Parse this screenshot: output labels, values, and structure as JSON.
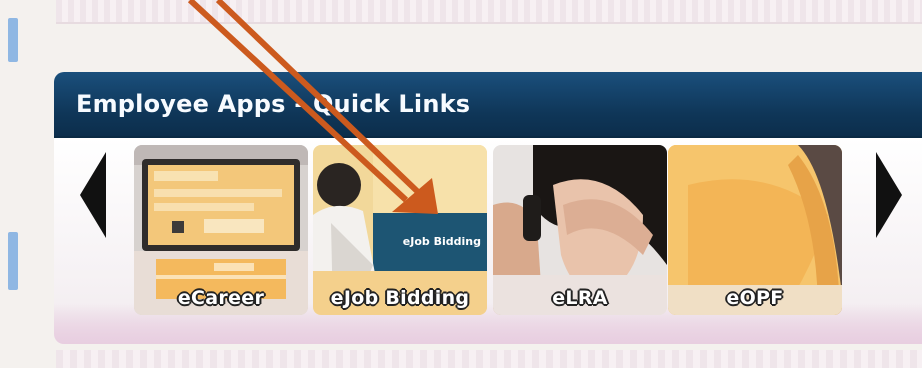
{
  "section": {
    "title": "Employee Apps - Quick Links"
  },
  "carousel": {
    "prev_icon": "triangle-left-icon",
    "next_icon": "triangle-right-icon",
    "tiles": [
      {
        "label": "eCareer"
      },
      {
        "label": "eJob Bidding",
        "sign_text": "eJob Bidding"
      },
      {
        "label": "eLRA"
      },
      {
        "label": "eOPF"
      }
    ]
  },
  "annotation": {
    "type": "arrow",
    "color": "#cc5a1e",
    "target": "eJob Bidding"
  },
  "colors": {
    "header": "#0f3658",
    "header_text": "#f7fbff",
    "arrow": "#cc5a1e",
    "tile_yellow": "#f7c35e"
  }
}
